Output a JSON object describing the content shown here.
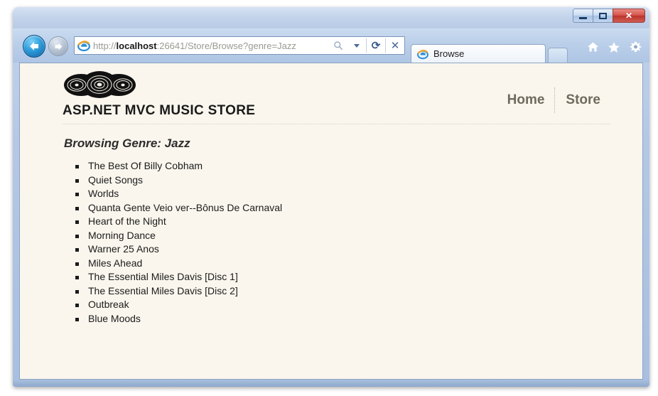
{
  "window": {
    "controls": {
      "minimize_label": "Minimize",
      "maximize_label": "Maximize",
      "close_label": "✕"
    }
  },
  "browser": {
    "back_label": "Back",
    "forward_label": "Forward",
    "address": {
      "scheme": "http://",
      "host": "localhost",
      "rest": ":26641/Store/Browse?genre=Jazz",
      "full_url": "http://localhost:26641/Store/Browse?genre=Jazz",
      "search_icon": "search-icon",
      "dropdown_icon": "chevron-down-icon",
      "refresh_glyph": "⟳",
      "stop_glyph": "✕"
    },
    "tabs": [
      {
        "label": "Browse",
        "favicon": "ie-icon",
        "active": true
      }
    ],
    "new_tab_label": "",
    "toolbar_icons": [
      {
        "name": "home-icon",
        "glyph": "⌂"
      },
      {
        "name": "favorites-icon",
        "glyph": "★"
      },
      {
        "name": "tools-icon",
        "glyph": "⚙"
      }
    ]
  },
  "page": {
    "logo_alt": "three-vinyl-records-logo",
    "site_title": "ASP.NET MVC MUSIC STORE",
    "nav": [
      {
        "label": "Home",
        "name": "nav-link-home"
      },
      {
        "label": "Store",
        "name": "nav-link-store"
      }
    ],
    "heading": "Browsing Genre: Jazz",
    "albums": [
      "The Best Of Billy Cobham",
      "Quiet Songs",
      "Worlds",
      "Quanta Gente Veio ver--Bônus De Carnaval",
      "Heart of the Night",
      "Morning Dance",
      "Warner 25 Anos",
      "Miles Ahead",
      "The Essential Miles Davis [Disc 1]",
      "The Essential Miles Davis [Disc 2]",
      "Outbreak",
      "Blue Moods"
    ]
  },
  "colors": {
    "page_background": "#faf6ed",
    "text": "#1b1b1b",
    "nav_link": "#6f6a5f",
    "window_frame": "#b4c8e6",
    "close_button": "#ba342c"
  }
}
